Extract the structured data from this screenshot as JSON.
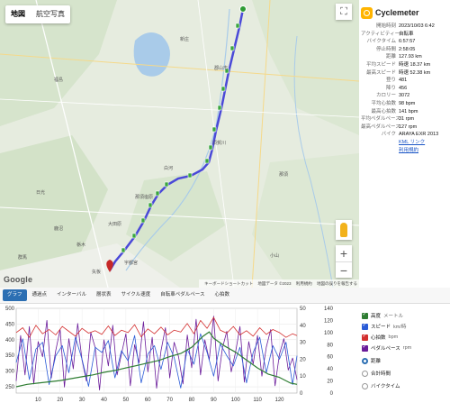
{
  "map": {
    "tabs": [
      "地図",
      "航空写真"
    ],
    "active_tab": 0,
    "fullscreen_icon": "fullscreen-icon",
    "zoom_in": "+",
    "zoom_out": "−",
    "logo": "Google",
    "footer": [
      "キーボードショートカット",
      "地図データ ©2023",
      "利用規約",
      "地図の誤りを報告する"
    ],
    "place_labels": [
      "新庄",
      "郡山市",
      "福島",
      "宇都宮",
      "日光",
      "群馬",
      "那須塩原",
      "須賀川",
      "栃木",
      "矢板",
      "大田原",
      "白河",
      "那須",
      "鹿沼",
      "小山"
    ],
    "route_color": "#4a49d8"
  },
  "info": {
    "app_name": "Cyclemeter",
    "stats": [
      {
        "k": "開始時刻",
        "v": "2023/10/03 6:42"
      },
      {
        "k": "アクティビティー",
        "v": "自転車"
      },
      {
        "k": "バイクタイム",
        "v": "6:57:57"
      },
      {
        "k": "停止時間",
        "v": "2:58:05"
      },
      {
        "k": "距離",
        "v": "127.93 km"
      },
      {
        "k": "平均スピード",
        "v": "時速 18.37 km"
      },
      {
        "k": "最高スピード",
        "v": "時速 52.38 km"
      },
      {
        "k": "登り",
        "v": "481"
      },
      {
        "k": "降り",
        "v": "456"
      },
      {
        "k": "カロリー",
        "v": "3072"
      },
      {
        "k": "平均心拍数",
        "v": "98 bpm"
      },
      {
        "k": "最高心拍数",
        "v": "141 bpm"
      },
      {
        "k": "平均ペダルペース",
        "v": "31 rpm"
      },
      {
        "k": "最高ペダルペース",
        "v": "127 rpm"
      },
      {
        "k": "バイク",
        "v": "ARAYA EXR 2013"
      }
    ],
    "kml_link": "KML リンク",
    "terms_link": "利用規約"
  },
  "tabs": [
    "グラフ",
    "通過点",
    "インターバル",
    "層状表",
    "サイクル速度",
    "自転車ペダルペース",
    "心拍数"
  ],
  "active_tab": 0,
  "legend": {
    "series": [
      {
        "name": "高度",
        "unit": "メートル",
        "color": "#2e7d32"
      },
      {
        "name": "スピード",
        "unit": "km/時",
        "color": "#2a5bd7"
      },
      {
        "name": "心拍数",
        "unit": "bpm",
        "color": "#d32f2f"
      },
      {
        "name": "ペダルペース",
        "unit": "rpm",
        "color": "#6a1b9a"
      }
    ],
    "x_options": [
      "距離",
      "合計時間",
      "バイクタイム"
    ],
    "x_selected": 0
  },
  "chart_data": {
    "type": "line",
    "x_ticks": [
      "10",
      "20",
      "30",
      "40",
      "50",
      "60",
      "70",
      "80",
      "90",
      "100",
      "110",
      "120"
    ],
    "xlim": [
      0,
      128
    ],
    "y_left_ticks": [
      "250",
      "300",
      "350",
      "400",
      "450",
      "500"
    ],
    "y_left_lim": [
      230,
      500
    ],
    "y_right1_ticks": [
      "0",
      "10",
      "20",
      "30",
      "40",
      "50"
    ],
    "y_right1_lim": [
      0,
      50
    ],
    "y_right2_ticks": [
      "0",
      "20",
      "40",
      "60",
      "80",
      "100",
      "120",
      "140"
    ],
    "y_right2_lim": [
      0,
      140
    ],
    "series": [
      {
        "name": "高度",
        "axis": "left",
        "color": "#2e7d32",
        "x": [
          0,
          5,
          10,
          15,
          20,
          25,
          30,
          35,
          40,
          45,
          50,
          55,
          60,
          65,
          70,
          75,
          80,
          85,
          88,
          90,
          95,
          100,
          105,
          110,
          115,
          120,
          125,
          128
        ],
        "values": [
          250,
          258,
          262,
          266,
          270,
          276,
          282,
          288,
          296,
          302,
          310,
          318,
          326,
          334,
          346,
          356,
          376,
          410,
          425,
          405,
          380,
          360,
          335,
          310,
          290,
          280,
          262,
          258
        ]
      },
      {
        "name": "スピード",
        "axis": "right1",
        "color": "#2a5bd7",
        "x": [
          0,
          3,
          6,
          9,
          12,
          15,
          18,
          21,
          24,
          27,
          30,
          33,
          36,
          39,
          42,
          45,
          48,
          51,
          54,
          57,
          60,
          63,
          66,
          69,
          72,
          75,
          78,
          81,
          84,
          87,
          90,
          93,
          96,
          99,
          102,
          105,
          108,
          111,
          114,
          117,
          120,
          123,
          126,
          128
        ],
        "values": [
          18,
          32,
          8,
          26,
          30,
          5,
          22,
          28,
          12,
          33,
          20,
          4,
          27,
          24,
          31,
          9,
          25,
          19,
          34,
          6,
          23,
          28,
          14,
          30,
          21,
          3,
          26,
          17,
          35,
          24,
          10,
          29,
          22,
          16,
          27,
          6,
          24,
          33,
          12,
          28,
          20,
          30,
          5,
          22
        ]
      },
      {
        "name": "心拍数",
        "axis": "right2",
        "color": "#d32f2f",
        "x": [
          0,
          3,
          6,
          9,
          12,
          15,
          18,
          21,
          24,
          27,
          30,
          33,
          36,
          39,
          42,
          45,
          48,
          51,
          54,
          57,
          60,
          63,
          66,
          69,
          72,
          75,
          78,
          81,
          84,
          87,
          90,
          93,
          96,
          99,
          102,
          105,
          108,
          111,
          114,
          117,
          120,
          123,
          126,
          128
        ],
        "values": [
          100,
          108,
          92,
          112,
          98,
          105,
          96,
          110,
          102,
          94,
          107,
          99,
          103,
          97,
          111,
          95,
          104,
          100,
          113,
          93,
          106,
          98,
          109,
          96,
          104,
          101,
          115,
          98,
          120,
          107,
          125,
          104,
          99,
          110,
          96,
          103,
          94,
          108,
          97,
          105,
          100,
          92,
          98,
          95
        ]
      },
      {
        "name": "ペダルペース",
        "axis": "right2",
        "color": "#6a1b9a",
        "x": [
          0,
          2,
          4,
          6,
          8,
          10,
          12,
          14,
          16,
          18,
          20,
          22,
          24,
          26,
          28,
          30,
          32,
          34,
          36,
          38,
          40,
          42,
          44,
          46,
          48,
          50,
          52,
          54,
          56,
          58,
          60,
          62,
          64,
          66,
          68,
          70,
          72,
          74,
          76,
          78,
          80,
          82,
          84,
          86,
          88,
          90,
          92,
          94,
          96,
          98,
          100,
          102,
          104,
          106,
          108,
          110,
          112,
          114,
          116,
          118,
          120,
          122,
          124,
          126,
          128
        ],
        "values": [
          20,
          95,
          30,
          110,
          15,
          85,
          60,
          120,
          25,
          70,
          105,
          10,
          90,
          40,
          115,
          55,
          20,
          100,
          75,
          5,
          88,
          45,
          112,
          30,
          65,
          98,
          12,
          80,
          50,
          118,
          35,
          92,
          8,
          70,
          108,
          25,
          84,
          60,
          15,
          96,
          42,
          122,
          30,
          88,
          55,
          127,
          20,
          74,
          102,
          35,
          68,
          110,
          18,
          85,
          48,
          95,
          28,
          76,
          105,
          12,
          64,
          90,
          38,
          58,
          22
        ]
      }
    ]
  }
}
